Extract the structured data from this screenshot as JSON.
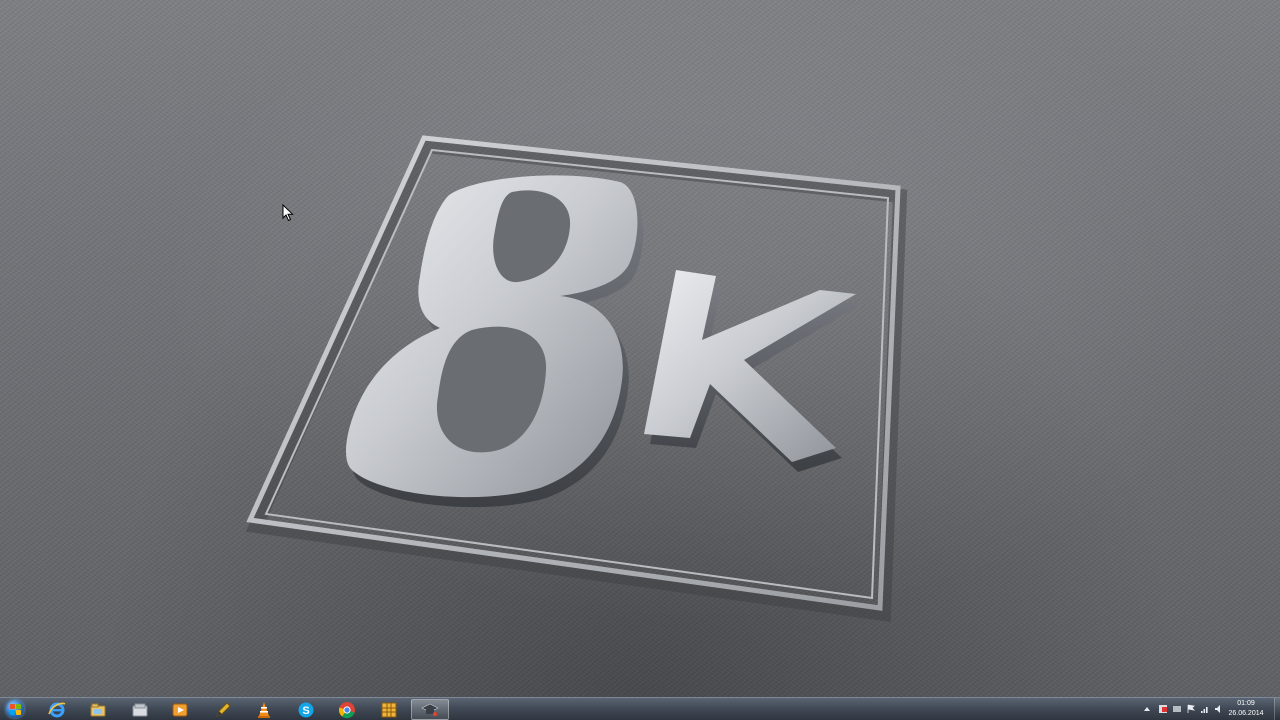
{
  "desktop": {
    "wallpaper_logo_text": "8k"
  },
  "taskbar": {
    "start_button": {
      "icon": "windows-start-orb-icon"
    },
    "pinned": [
      {
        "id": "ie",
        "icon": "internet-explorer-icon"
      },
      {
        "id": "explorer",
        "icon": "windows-explorer-icon"
      },
      {
        "id": "folder",
        "icon": "folder-icon"
      },
      {
        "id": "media-player",
        "icon": "media-player-icon"
      },
      {
        "id": "tool",
        "icon": "pencil-tool-icon"
      },
      {
        "id": "vlc",
        "icon": "vlc-cone-icon"
      },
      {
        "id": "skype",
        "icon": "skype-icon",
        "letter": "S"
      },
      {
        "id": "chrome",
        "icon": "chrome-icon"
      },
      {
        "id": "grid-app",
        "icon": "grid-app-icon"
      },
      {
        "id": "active-app",
        "icon": "graduation-cap-icon",
        "active": true
      }
    ],
    "tray": {
      "icons": [
        "show-hidden-icons-arrow-icon",
        "tray-app-red-icon",
        "tray-app-gray-icon",
        "tray-app-flag-icon",
        "network-signal-icon",
        "volume-icon"
      ],
      "clock": {
        "time": "01:09",
        "date": "26.06.2014"
      }
    }
  },
  "colors": {
    "taskbar_top": "#5a6472",
    "taskbar_bottom": "#2f3640",
    "wallpaper": "#6f7176",
    "logo_metal": "#d4d6da"
  }
}
